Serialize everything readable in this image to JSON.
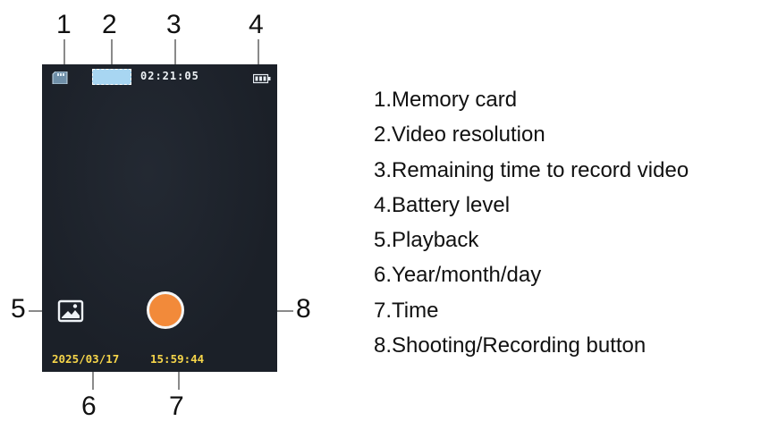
{
  "screen": {
    "memory_card_icon": "sd-card-icon",
    "resolution_badge": "",
    "remaining_time": "02:21:05",
    "battery_icon": "battery-icon",
    "playback_icon": "image-icon",
    "record_button_color": "#f28a3a",
    "date": "2025/03/17",
    "time": "15:59:44",
    "colors": {
      "screen_bg": "#1b2028",
      "overlay_text": "#eef2f6",
      "timestamp_text": "#f7d64a",
      "resolution_badge": "#a8d6f2"
    }
  },
  "callouts": [
    "1",
    "2",
    "3",
    "4",
    "5",
    "6",
    "7",
    "8"
  ],
  "legend": [
    "1.Memory card",
    "2.Video resolution",
    "3.Remaining time to record video",
    "4.Battery level",
    "5.Playback",
    "6.Year/month/day",
    "7.Time",
    "8.Shooting/Recording button"
  ]
}
